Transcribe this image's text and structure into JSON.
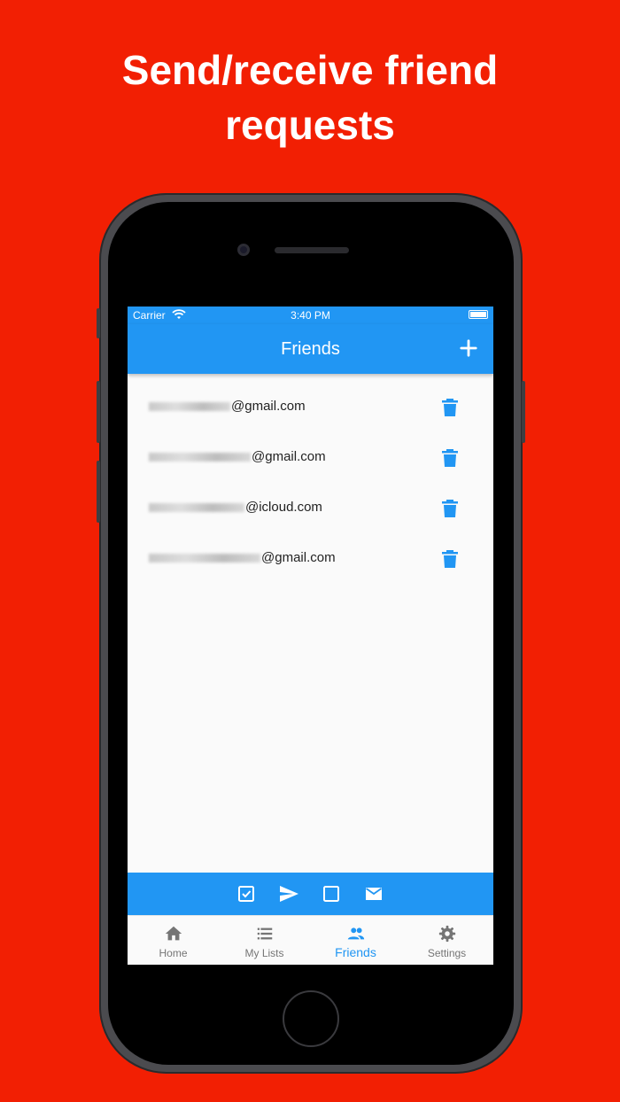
{
  "headline": {
    "line1": "Send/receive friend",
    "line2": "requests"
  },
  "status_bar": {
    "carrier": "Carrier",
    "time": "3:40 PM"
  },
  "app_bar": {
    "title": "Friends",
    "add_icon": "plus-icon"
  },
  "friends": [
    {
      "email_domain": "@gmail.com",
      "action_icon": "trash-icon"
    },
    {
      "email_domain": "@gmail.com",
      "action_icon": "trash-icon"
    },
    {
      "email_domain": "@icloud.com",
      "action_icon": "trash-icon"
    },
    {
      "email_domain": "@gmail.com",
      "action_icon": "trash-icon"
    }
  ],
  "toolbar": {
    "icons": [
      "check-box-icon",
      "send-icon",
      "empty-box-icon",
      "mail-icon"
    ]
  },
  "bottom_nav": {
    "items": [
      {
        "label": "Home",
        "icon": "home-icon"
      },
      {
        "label": "My Lists",
        "icon": "list-icon"
      },
      {
        "label": "Friends",
        "icon": "people-icon",
        "active": true
      },
      {
        "label": "Settings",
        "icon": "gear-icon"
      }
    ]
  },
  "colors": {
    "background": "#f21f03",
    "primary": "#2196f3",
    "inactive": "#757575"
  }
}
